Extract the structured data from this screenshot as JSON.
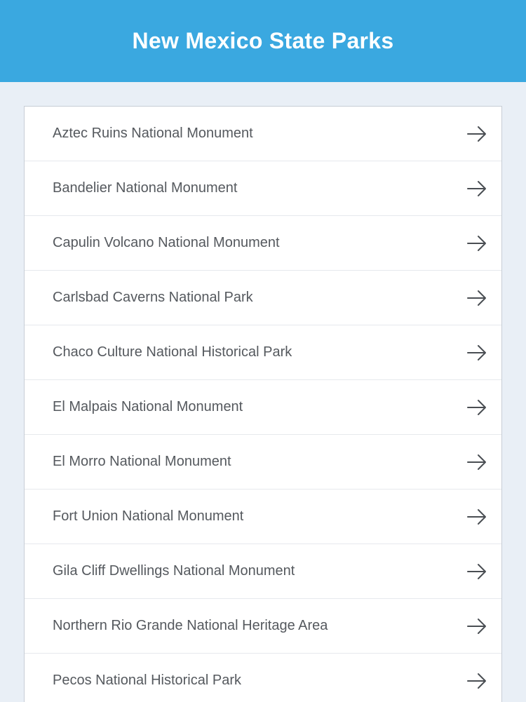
{
  "header": {
    "title": "New Mexico State Parks",
    "color": "#3aa8e0"
  },
  "parks": [
    {
      "label": "Aztec Ruins National Monument",
      "icon": "arrow-right-icon"
    },
    {
      "label": "Bandelier National Monument",
      "icon": "arrow-right-icon"
    },
    {
      "label": "Capulin Volcano National Monument",
      "icon": "arrow-right-icon"
    },
    {
      "label": "Carlsbad Caverns National Park",
      "icon": "arrow-right-icon"
    },
    {
      "label": "Chaco Culture National Historical Park",
      "icon": "arrow-right-icon"
    },
    {
      "label": "El Malpais National Monument",
      "icon": "arrow-right-icon"
    },
    {
      "label": "El Morro National Monument",
      "icon": "arrow-right-icon"
    },
    {
      "label": "Fort Union National Monument",
      "icon": "arrow-right-icon"
    },
    {
      "label": "Gila Cliff Dwellings National Monument",
      "icon": "arrow-right-icon"
    },
    {
      "label": "Northern Rio Grande National Heritage Area",
      "icon": "arrow-right-icon"
    },
    {
      "label": "Pecos National Historical Park",
      "icon": "arrow-right-icon"
    }
  ]
}
